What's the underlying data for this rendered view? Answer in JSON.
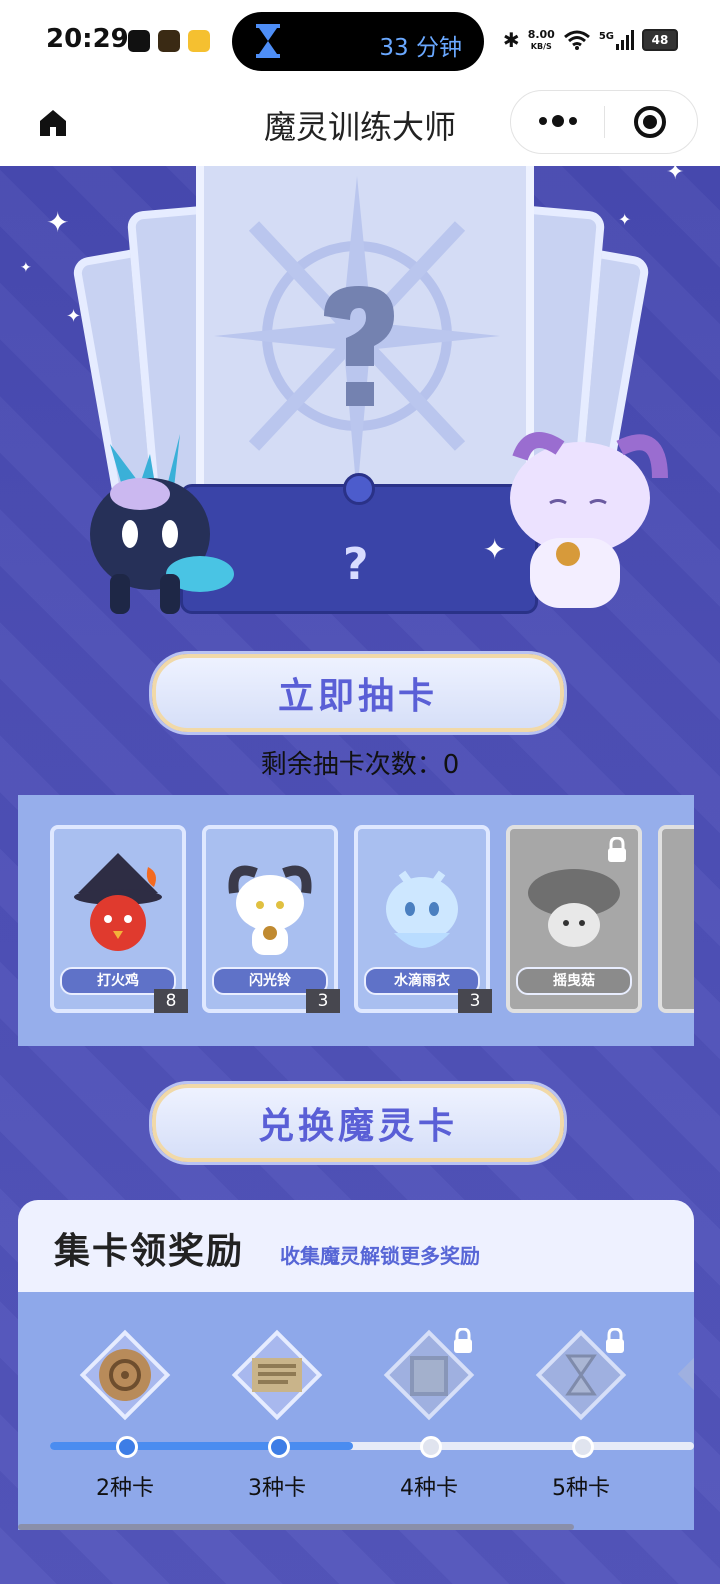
{
  "status_bar": {
    "time": "20:29",
    "timer_text": "33 分钟",
    "net_speed": "8.00",
    "net_unit": "KB/S",
    "signal": "5G",
    "battery": "48"
  },
  "nav": {
    "title": "魔灵训练大师"
  },
  "draw": {
    "button_label": "立即抽卡",
    "remaining_text": "剩余抽卡次数：0"
  },
  "cards": [
    {
      "name": "打火鸡",
      "count": "8",
      "locked": false
    },
    {
      "name": "闪光铃",
      "count": "3",
      "locked": false
    },
    {
      "name": "水滴雨衣",
      "count": "3",
      "locked": false
    },
    {
      "name": "摇曳菇",
      "count": "",
      "locked": true
    }
  ],
  "exchange": {
    "button_label": "兑换魔灵卡"
  },
  "rewards": {
    "title": "集卡领奖励",
    "subtitle": "收集魔灵解锁更多奖励",
    "progress": 0.47,
    "tiers": [
      {
        "label": "2种卡",
        "unlocked": true
      },
      {
        "label": "3种卡",
        "unlocked": true
      },
      {
        "label": "4种卡",
        "unlocked": false
      },
      {
        "label": "5种卡",
        "unlocked": false
      }
    ]
  },
  "colors": {
    "background": "#4d4fb4",
    "accent_blue": "#4a8cf0",
    "button_text": "#5a5fd6"
  }
}
